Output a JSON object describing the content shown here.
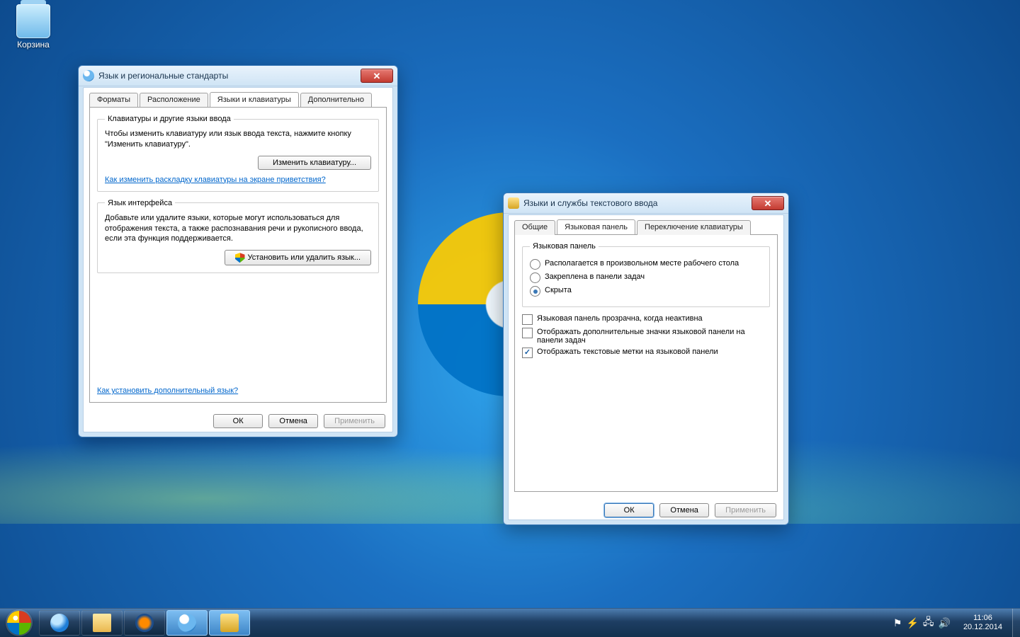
{
  "desktop": {
    "recycle_bin": "Корзина"
  },
  "win1": {
    "title": "Язык и региональные стандарты",
    "tabs": [
      "Форматы",
      "Расположение",
      "Языки и клавиатуры",
      "Дополнительно"
    ],
    "active_tab": 2,
    "group1": {
      "legend": "Клавиатуры и другие языки ввода",
      "text": "Чтобы изменить клавиатуру или язык ввода текста, нажмите кнопку \"Изменить клавиатуру\".",
      "button": "Изменить клавиатуру...",
      "link": "Как изменить раскладку клавиатуры на экране приветствия?"
    },
    "group2": {
      "legend": "Язык интерфейса",
      "text": "Добавьте или удалите языки, которые могут использоваться для отображения текста, а также распознавания речи и рукописного ввода, если эта функция поддерживается.",
      "button": "Установить или удалить язык..."
    },
    "bottom_link": "Как установить дополнительный язык?",
    "ok": "ОК",
    "cancel": "Отмена",
    "apply": "Применить"
  },
  "win2": {
    "title": "Языки и службы текстового ввода",
    "tabs": [
      "Общие",
      "Языковая панель",
      "Переключение клавиатуры"
    ],
    "active_tab": 1,
    "group": {
      "legend": "Языковая панель",
      "radios": [
        {
          "label": "Располагается в произвольном месте рабочего стола",
          "checked": false
        },
        {
          "label": "Закреплена в панели задач",
          "checked": false
        },
        {
          "label": "Скрыта",
          "checked": true
        }
      ]
    },
    "checks": [
      {
        "label": "Языковая панель прозрачна, когда неактивна",
        "checked": false
      },
      {
        "label": "Отображать дополнительные значки языковой панели на панели задач",
        "checked": false
      },
      {
        "label": "Отображать текстовые метки на языковой панели",
        "checked": true
      }
    ],
    "ok": "ОК",
    "cancel": "Отмена",
    "apply": "Применить"
  },
  "taskbar": {
    "time": "11:06",
    "date": "20.12.2014"
  }
}
